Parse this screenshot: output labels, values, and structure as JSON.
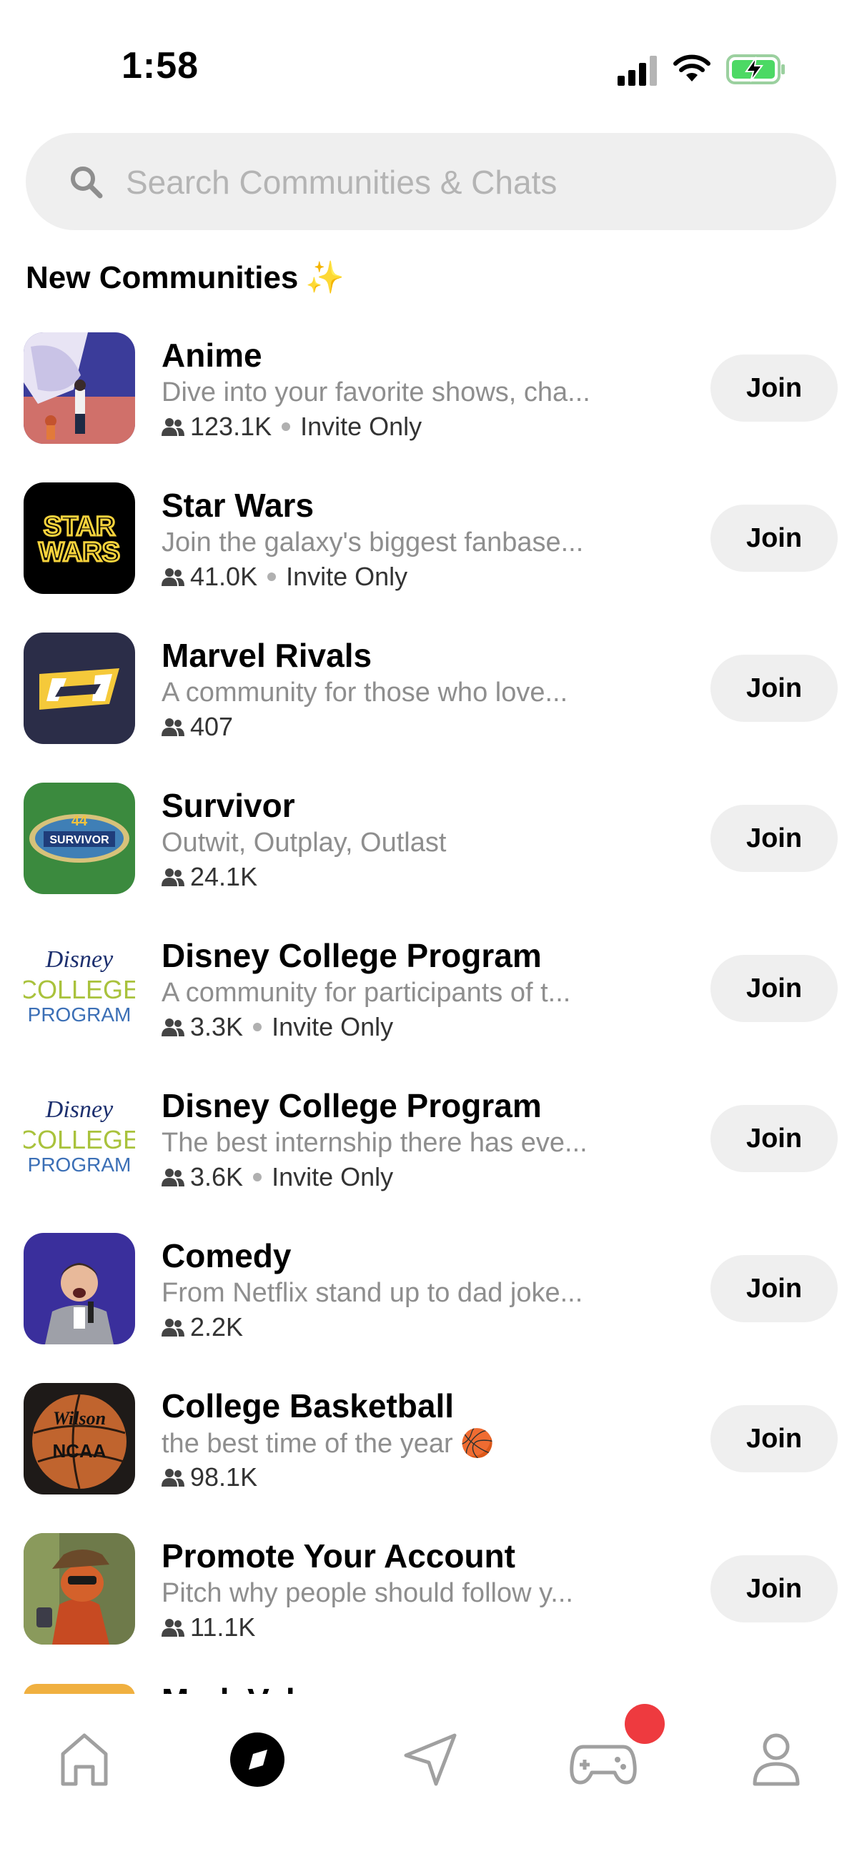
{
  "status_bar": {
    "time": "1:58"
  },
  "search": {
    "placeholder": "Search Communities & Chats"
  },
  "section": {
    "title": "New Communities",
    "sparkle": "✨"
  },
  "communities": [
    {
      "name": "Anime",
      "description": "Dive into your favorite shows, cha...",
      "members": "123.1K",
      "access": "Invite Only",
      "join": "Join"
    },
    {
      "name": "Star Wars",
      "description": "Join the galaxy's biggest fanbase...",
      "members": "41.0K",
      "access": "Invite Only",
      "join": "Join"
    },
    {
      "name": "Marvel Rivals",
      "description": "A community for those who love...",
      "members": "407",
      "access": "",
      "join": "Join"
    },
    {
      "name": "Survivor",
      "description": "Outwit, Outplay, Outlast",
      "members": "24.1K",
      "access": "",
      "join": "Join"
    },
    {
      "name": "Disney College Program",
      "description": "A community for participants of t...",
      "members": "3.3K",
      "access": "Invite Only",
      "join": "Join"
    },
    {
      "name": "Disney College Program",
      "description": "The best internship there has eve...",
      "members": "3.6K",
      "access": "Invite Only",
      "join": "Join"
    },
    {
      "name": "Comedy",
      "description": "From Netflix stand up to dad joke...",
      "members": "2.2K",
      "access": "",
      "join": "Join"
    },
    {
      "name": "College Basketball",
      "description": "the best time of the year 🏀",
      "members": "98.1K",
      "access": "",
      "join": "Join"
    },
    {
      "name": "Promote Your Account",
      "description": "Pitch why people should follow y...",
      "members": "11.1K",
      "access": "",
      "join": "Join"
    }
  ],
  "thumb_text": {
    "star_wars_1": "STAR",
    "star_wars_2": "WARS",
    "survivor_num": "44",
    "survivor": "SURVIVOR",
    "disney": "Disney",
    "college": "COLLEGE",
    "program": "PROGRAM",
    "wilson": "Wilson",
    "ncaa": "NCAA"
  },
  "cutoff_row": {
    "name": "Mark Valo"
  },
  "tabs": [
    "home-icon",
    "explore-icon",
    "send-icon",
    "gamepad-icon",
    "profile-icon"
  ],
  "colors": {
    "badge": "#ee3a3f",
    "battery": "#4cd964",
    "join_bg": "#efefef"
  }
}
